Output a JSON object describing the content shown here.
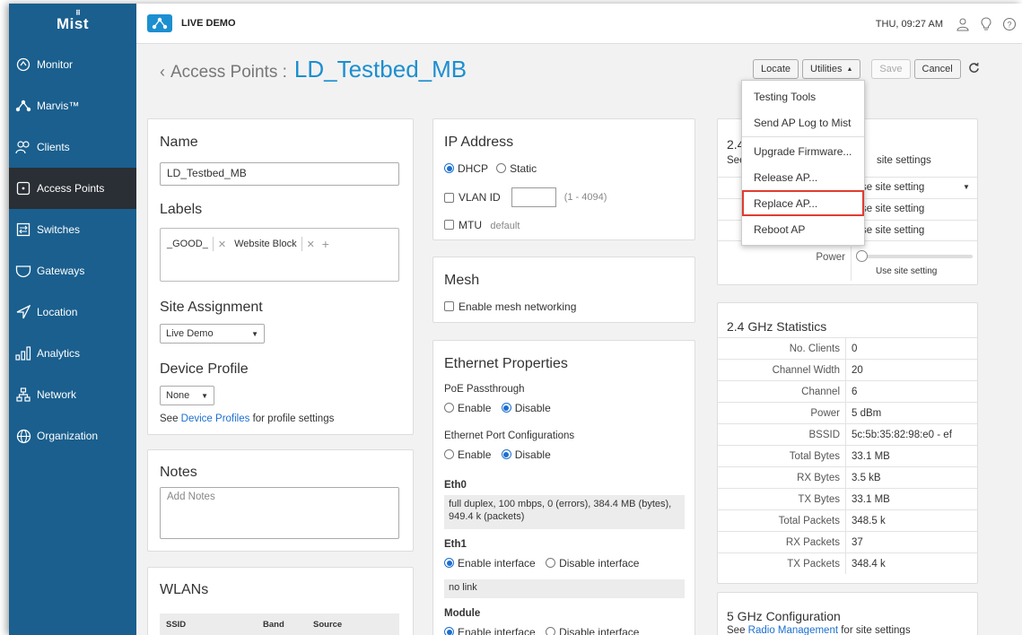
{
  "sidebar": {
    "logo": "Mist",
    "items": [
      {
        "label": "Monitor",
        "icon": "monitor-icon"
      },
      {
        "label": "Marvis™",
        "icon": "marvis-icon"
      },
      {
        "label": "Clients",
        "icon": "clients-icon"
      },
      {
        "label": "Access Points",
        "icon": "access-point-icon",
        "active": true
      },
      {
        "label": "Switches",
        "icon": "switches-icon"
      },
      {
        "label": "Gateways",
        "icon": "gateways-icon"
      },
      {
        "label": "Location",
        "icon": "location-icon"
      },
      {
        "label": "Analytics",
        "icon": "analytics-icon"
      },
      {
        "label": "Network",
        "icon": "network-icon"
      },
      {
        "label": "Organization",
        "icon": "organization-icon"
      }
    ]
  },
  "topbar": {
    "site_label": "LIVE DEMO",
    "time": "THU, 09:27 AM"
  },
  "header": {
    "breadcrumb": "Access Points :",
    "ap_name": "LD_Testbed_MB",
    "buttons": {
      "locate": "Locate",
      "utilities": "Utilities",
      "save": "Save",
      "cancel": "Cancel"
    }
  },
  "utilities_menu": {
    "items": [
      "Testing Tools",
      "Send AP Log to Mist",
      "Upgrade Firmware...",
      "Release AP...",
      "Replace AP...",
      "Reboot AP"
    ],
    "highlighted": "Replace AP..."
  },
  "name_card": {
    "name_title": "Name",
    "name_value": "LD_Testbed_MB",
    "labels_title": "Labels",
    "labels": [
      "_GOOD_",
      "Website Block"
    ],
    "site_title": "Site Assignment",
    "site_value": "Live Demo",
    "profile_title": "Device Profile",
    "profile_value": "None",
    "profile_note_pre": "See ",
    "profile_note_link": "Device Profiles",
    "profile_note_post": " for profile settings"
  },
  "notes_card": {
    "title": "Notes",
    "placeholder": "Add Notes"
  },
  "wlans_card": {
    "title": "WLANs",
    "columns": [
      "SSID",
      "Band",
      "Source"
    ]
  },
  "ip_card": {
    "title": "IP Address",
    "dhcp": "DHCP",
    "static": "Static",
    "vlan_label": "VLAN ID",
    "vlan_range": "(1 - 4094)",
    "mtu_label": "MTU",
    "mtu_value": "default"
  },
  "mesh_card": {
    "title": "Mesh",
    "enable_label": "Enable mesh networking"
  },
  "ethernet_card": {
    "title": "Ethernet Properties",
    "poe_label": "PoE Passthrough",
    "enable": "Enable",
    "disable": "Disable",
    "port_conf_label": "Ethernet Port Configurations",
    "eth0_label": "Eth0",
    "eth0_status": "full duplex, 100 mbps, 0 (errors), 384.4 MB (bytes), 949.4 k (packets)",
    "eth1_label": "Eth1",
    "enable_interface": "Enable interface",
    "disable_interface": "Disable interface",
    "eth1_status": "no link",
    "module_label": "Module"
  },
  "radio24_card": {
    "title_partial": "2.4",
    "see_partial": "See",
    "site_settings": "site settings",
    "rows": [
      "se site setting",
      "se site setting",
      "se site setting"
    ],
    "power_label": "Power",
    "power_value": "Use site setting"
  },
  "stats24_card": {
    "title": "2.4 GHz Statistics",
    "rows": [
      {
        "k": "No. Clients",
        "v": "0"
      },
      {
        "k": "Channel Width",
        "v": "20"
      },
      {
        "k": "Channel",
        "v": "6"
      },
      {
        "k": "Power",
        "v": "5 dBm"
      },
      {
        "k": "BSSID",
        "v": "5c:5b:35:82:98:e0 - ef"
      },
      {
        "k": "Total Bytes",
        "v": "33.1 MB"
      },
      {
        "k": "RX Bytes",
        "v": "3.5 kB"
      },
      {
        "k": "TX Bytes",
        "v": "33.1 MB"
      },
      {
        "k": "Total Packets",
        "v": "348.5 k"
      },
      {
        "k": "RX Packets",
        "v": "37"
      },
      {
        "k": "TX Packets",
        "v": "348.4 k"
      }
    ]
  },
  "config5_card": {
    "title": "5 GHz Configuration",
    "note_pre": "See ",
    "note_link": "Radio Management",
    "note_post": " for site settings"
  }
}
